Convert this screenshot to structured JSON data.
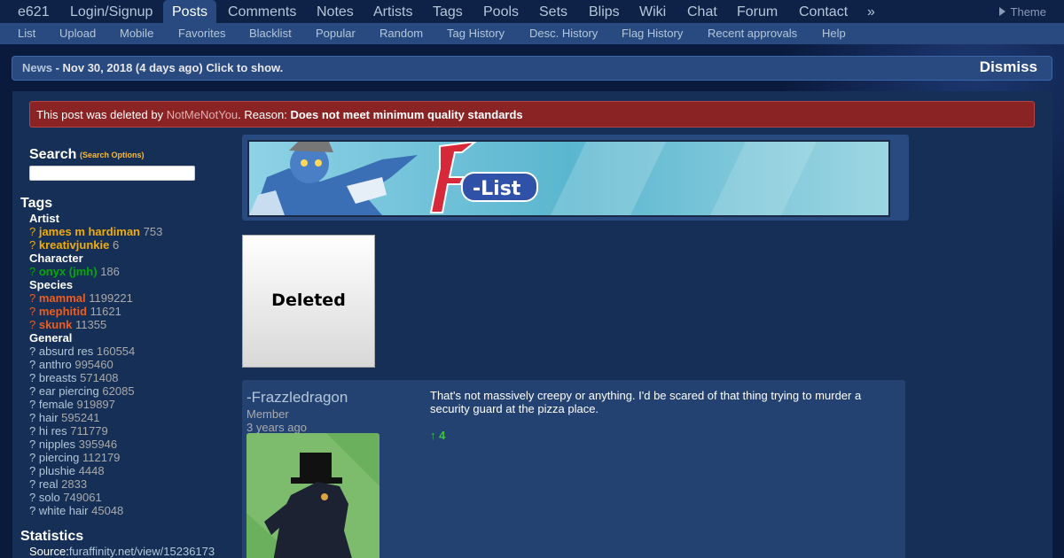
{
  "nav": {
    "main": [
      "e621",
      "Login/Signup",
      "Posts",
      "Comments",
      "Notes",
      "Artists",
      "Tags",
      "Pools",
      "Sets",
      "Blips",
      "Wiki",
      "Chat",
      "Forum",
      "Contact",
      "»"
    ],
    "active": "Posts",
    "theme_label": "Theme",
    "sub": [
      "List",
      "Upload",
      "Mobile",
      "Favorites",
      "Blacklist",
      "Popular",
      "Random",
      "Tag History",
      "Desc. History",
      "Flag History",
      "Recent approvals",
      "Help"
    ]
  },
  "news": {
    "label": "News",
    "text": " - Nov 30, 2018 (4 days ago) Click to show.",
    "dismiss": "Dismiss"
  },
  "notice": {
    "prefix": "This post was deleted by ",
    "user": "NotMeNotYou",
    "middle": ". Reason: ",
    "reason": "Does not meet minimum quality standards"
  },
  "search": {
    "title": "Search",
    "options": "(Search Options)",
    "value": ""
  },
  "tags": {
    "title": "Tags",
    "artist_label": "Artist",
    "artist": [
      {
        "name": "james m hardiman",
        "count": "753"
      },
      {
        "name": "kreativjunkie",
        "count": "6"
      }
    ],
    "character_label": "Character",
    "character": [
      {
        "name": "onyx (jmh)",
        "count": "186"
      }
    ],
    "species_label": "Species",
    "species": [
      {
        "name": "mammal",
        "count": "1199221"
      },
      {
        "name": "mephitid",
        "count": "11621"
      },
      {
        "name": "skunk",
        "count": "11355"
      }
    ],
    "general_label": "General",
    "general": [
      {
        "name": "absurd res",
        "count": "160554"
      },
      {
        "name": "anthro",
        "count": "995460"
      },
      {
        "name": "breasts",
        "count": "571408"
      },
      {
        "name": "ear piercing",
        "count": "62085"
      },
      {
        "name": "female",
        "count": "919897"
      },
      {
        "name": "hair",
        "count": "595241"
      },
      {
        "name": "hi res",
        "count": "711779"
      },
      {
        "name": "nipples",
        "count": "395946"
      },
      {
        "name": "piercing",
        "count": "112179"
      },
      {
        "name": "plushie",
        "count": "4448"
      },
      {
        "name": "real",
        "count": "2833"
      },
      {
        "name": "solo",
        "count": "749061"
      },
      {
        "name": "white hair",
        "count": "45048"
      }
    ]
  },
  "statistics": {
    "title": "Statistics",
    "source_label": "Source:",
    "source_value": "furaffinity.net/view/15236173"
  },
  "banner": {
    "logo_text": "F-List"
  },
  "deleted_thumb": {
    "label": "Deleted"
  },
  "comment": {
    "author": "-Frazzledragon",
    "level": "Member",
    "time": "3 years ago",
    "body": "That's not massively creepy or anything. I'd be scared of that thing trying to murder a security guard at the pizza place.",
    "votes": "↑ 4"
  },
  "colors": {
    "background": "#0a1a3d",
    "nav_active": "#284a81",
    "link": "#b4c7d9",
    "artist": "#f2ac08",
    "character": "#00aa00",
    "species": "#ed5d1f",
    "notice": "#8a2324"
  }
}
